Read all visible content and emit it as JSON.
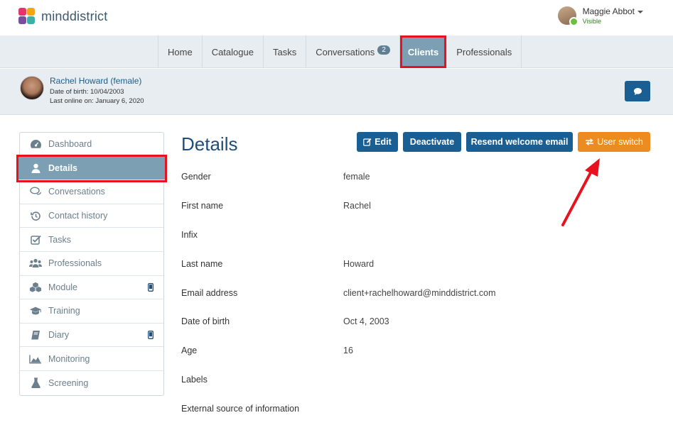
{
  "brand": {
    "name": "minddistrict"
  },
  "user": {
    "name": "Maggie Abbot",
    "status": "Visible"
  },
  "nav": [
    {
      "label": "Home"
    },
    {
      "label": "Catalogue"
    },
    {
      "label": "Tasks"
    },
    {
      "label": "Conversations",
      "badge": "2"
    },
    {
      "label": "Clients",
      "active": true
    },
    {
      "label": "Professionals"
    }
  ],
  "client": {
    "name": "Rachel Howard (female)",
    "dob": "Date of birth: 10/04/2003",
    "last_online": "Last online on: January 6, 2020"
  },
  "sidebar": [
    {
      "label": "Dashboard",
      "icon": "dashboard-icon"
    },
    {
      "label": "Details",
      "icon": "user-icon",
      "active": true
    },
    {
      "label": "Conversations",
      "icon": "chat-bubbles-icon"
    },
    {
      "label": "Contact history",
      "icon": "history-icon"
    },
    {
      "label": "Tasks",
      "icon": "checkbox-icon"
    },
    {
      "label": "Professionals",
      "icon": "group-icon"
    },
    {
      "label": "Module",
      "icon": "cubes-icon",
      "mobile": true
    },
    {
      "label": "Training",
      "icon": "graduation-cap-icon"
    },
    {
      "label": "Diary",
      "icon": "book-icon",
      "mobile": true
    },
    {
      "label": "Monitoring",
      "icon": "area-chart-icon"
    },
    {
      "label": "Screening",
      "icon": "flask-icon"
    }
  ],
  "main": {
    "title": "Details",
    "buttons": {
      "edit": "Edit",
      "deactivate": "Deactivate",
      "resend": "Resend welcome email",
      "user_switch": "User switch"
    },
    "fields": [
      {
        "label": "Gender",
        "value": "female"
      },
      {
        "label": "First name",
        "value": "Rachel"
      },
      {
        "label": "Infix",
        "value": ""
      },
      {
        "label": "Last name",
        "value": "Howard"
      },
      {
        "label": "Email address",
        "value": "client+rachelhoward@minddistrict.com"
      },
      {
        "label": "Date of birth",
        "value": "Oct 4, 2003"
      },
      {
        "label": "Age",
        "value": "16"
      },
      {
        "label": "Labels",
        "value": ""
      },
      {
        "label": "External source of information",
        "value": ""
      }
    ]
  },
  "colors": {
    "primary": "#1a5f93",
    "warning": "#ec8b1f",
    "active": "#7c9fb3",
    "highlight": "#e8121f"
  }
}
